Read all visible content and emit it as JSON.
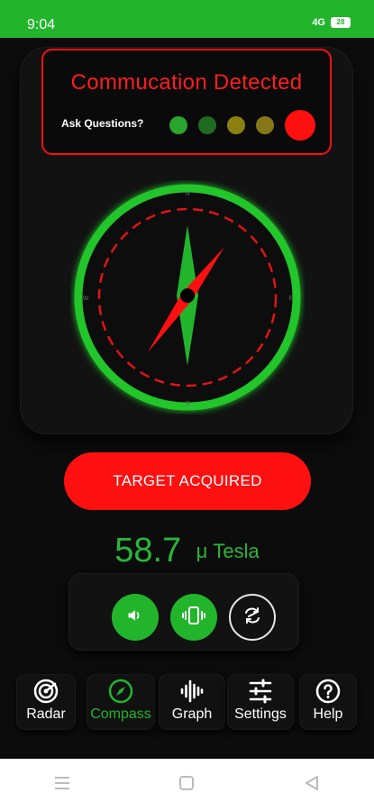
{
  "status_bar": {
    "time": "9:04",
    "signal": "4G",
    "battery": "28"
  },
  "detection": {
    "title": "Commucation Detected",
    "ask_label": "Ask Questions?",
    "indicator_colors": [
      "#2aa52e",
      "#1f6b22",
      "#8b8110",
      "#857716",
      "#ff1010"
    ]
  },
  "compass": {
    "north": "N",
    "south": "S",
    "east": "E",
    "west": "W",
    "ring_color": "#22c52c",
    "needle_colors": [
      "#22b52c",
      "#ff1010"
    ]
  },
  "target_button": {
    "label": "TARGET ACQUIRED",
    "color": "#ff1010"
  },
  "reading": {
    "value": "58.7",
    "unit": "μ Tesla"
  },
  "controls": {
    "sound_icon": "speaker-icon",
    "vibrate_icon": "vibrate-icon",
    "switch_icon": "swap-icon"
  },
  "nav": {
    "items": [
      {
        "label": "Radar",
        "icon": "radar-icon"
      },
      {
        "label": "Compass",
        "icon": "compass-icon"
      },
      {
        "label": "Graph",
        "icon": "waveform-icon"
      },
      {
        "label": "Settings",
        "icon": "sliders-icon"
      },
      {
        "label": "Help",
        "icon": "help-icon"
      }
    ],
    "active": "Compass",
    "active_color": "#22b52c"
  }
}
